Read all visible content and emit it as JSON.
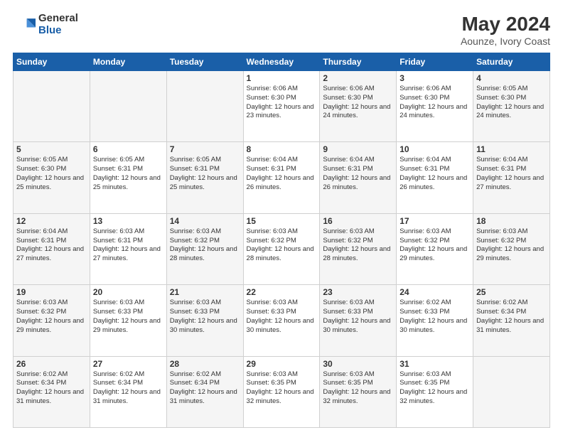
{
  "logo": {
    "general": "General",
    "blue": "Blue"
  },
  "title": "May 2024",
  "location": "Aounze, Ivory Coast",
  "days_of_week": [
    "Sunday",
    "Monday",
    "Tuesday",
    "Wednesday",
    "Thursday",
    "Friday",
    "Saturday"
  ],
  "weeks": [
    [
      {
        "day": "",
        "info": ""
      },
      {
        "day": "",
        "info": ""
      },
      {
        "day": "",
        "info": ""
      },
      {
        "day": "1",
        "info": "Sunrise: 6:06 AM\nSunset: 6:30 PM\nDaylight: 12 hours\nand 23 minutes."
      },
      {
        "day": "2",
        "info": "Sunrise: 6:06 AM\nSunset: 6:30 PM\nDaylight: 12 hours\nand 24 minutes."
      },
      {
        "day": "3",
        "info": "Sunrise: 6:06 AM\nSunset: 6:30 PM\nDaylight: 12 hours\nand 24 minutes."
      },
      {
        "day": "4",
        "info": "Sunrise: 6:05 AM\nSunset: 6:30 PM\nDaylight: 12 hours\nand 24 minutes."
      }
    ],
    [
      {
        "day": "5",
        "info": "Sunrise: 6:05 AM\nSunset: 6:30 PM\nDaylight: 12 hours\nand 25 minutes."
      },
      {
        "day": "6",
        "info": "Sunrise: 6:05 AM\nSunset: 6:31 PM\nDaylight: 12 hours\nand 25 minutes."
      },
      {
        "day": "7",
        "info": "Sunrise: 6:05 AM\nSunset: 6:31 PM\nDaylight: 12 hours\nand 25 minutes."
      },
      {
        "day": "8",
        "info": "Sunrise: 6:04 AM\nSunset: 6:31 PM\nDaylight: 12 hours\nand 26 minutes."
      },
      {
        "day": "9",
        "info": "Sunrise: 6:04 AM\nSunset: 6:31 PM\nDaylight: 12 hours\nand 26 minutes."
      },
      {
        "day": "10",
        "info": "Sunrise: 6:04 AM\nSunset: 6:31 PM\nDaylight: 12 hours\nand 26 minutes."
      },
      {
        "day": "11",
        "info": "Sunrise: 6:04 AM\nSunset: 6:31 PM\nDaylight: 12 hours\nand 27 minutes."
      }
    ],
    [
      {
        "day": "12",
        "info": "Sunrise: 6:04 AM\nSunset: 6:31 PM\nDaylight: 12 hours\nand 27 minutes."
      },
      {
        "day": "13",
        "info": "Sunrise: 6:03 AM\nSunset: 6:31 PM\nDaylight: 12 hours\nand 27 minutes."
      },
      {
        "day": "14",
        "info": "Sunrise: 6:03 AM\nSunset: 6:32 PM\nDaylight: 12 hours\nand 28 minutes."
      },
      {
        "day": "15",
        "info": "Sunrise: 6:03 AM\nSunset: 6:32 PM\nDaylight: 12 hours\nand 28 minutes."
      },
      {
        "day": "16",
        "info": "Sunrise: 6:03 AM\nSunset: 6:32 PM\nDaylight: 12 hours\nand 28 minutes."
      },
      {
        "day": "17",
        "info": "Sunrise: 6:03 AM\nSunset: 6:32 PM\nDaylight: 12 hours\nand 29 minutes."
      },
      {
        "day": "18",
        "info": "Sunrise: 6:03 AM\nSunset: 6:32 PM\nDaylight: 12 hours\nand 29 minutes."
      }
    ],
    [
      {
        "day": "19",
        "info": "Sunrise: 6:03 AM\nSunset: 6:32 PM\nDaylight: 12 hours\nand 29 minutes."
      },
      {
        "day": "20",
        "info": "Sunrise: 6:03 AM\nSunset: 6:33 PM\nDaylight: 12 hours\nand 29 minutes."
      },
      {
        "day": "21",
        "info": "Sunrise: 6:03 AM\nSunset: 6:33 PM\nDaylight: 12 hours\nand 30 minutes."
      },
      {
        "day": "22",
        "info": "Sunrise: 6:03 AM\nSunset: 6:33 PM\nDaylight: 12 hours\nand 30 minutes."
      },
      {
        "day": "23",
        "info": "Sunrise: 6:03 AM\nSunset: 6:33 PM\nDaylight: 12 hours\nand 30 minutes."
      },
      {
        "day": "24",
        "info": "Sunrise: 6:02 AM\nSunset: 6:33 PM\nDaylight: 12 hours\nand 30 minutes."
      },
      {
        "day": "25",
        "info": "Sunrise: 6:02 AM\nSunset: 6:34 PM\nDaylight: 12 hours\nand 31 minutes."
      }
    ],
    [
      {
        "day": "26",
        "info": "Sunrise: 6:02 AM\nSunset: 6:34 PM\nDaylight: 12 hours\nand 31 minutes."
      },
      {
        "day": "27",
        "info": "Sunrise: 6:02 AM\nSunset: 6:34 PM\nDaylight: 12 hours\nand 31 minutes."
      },
      {
        "day": "28",
        "info": "Sunrise: 6:02 AM\nSunset: 6:34 PM\nDaylight: 12 hours\nand 31 minutes."
      },
      {
        "day": "29",
        "info": "Sunrise: 6:03 AM\nSunset: 6:35 PM\nDaylight: 12 hours\nand 32 minutes."
      },
      {
        "day": "30",
        "info": "Sunrise: 6:03 AM\nSunset: 6:35 PM\nDaylight: 12 hours\nand 32 minutes."
      },
      {
        "day": "31",
        "info": "Sunrise: 6:03 AM\nSunset: 6:35 PM\nDaylight: 12 hours\nand 32 minutes."
      },
      {
        "day": "",
        "info": ""
      }
    ]
  ]
}
